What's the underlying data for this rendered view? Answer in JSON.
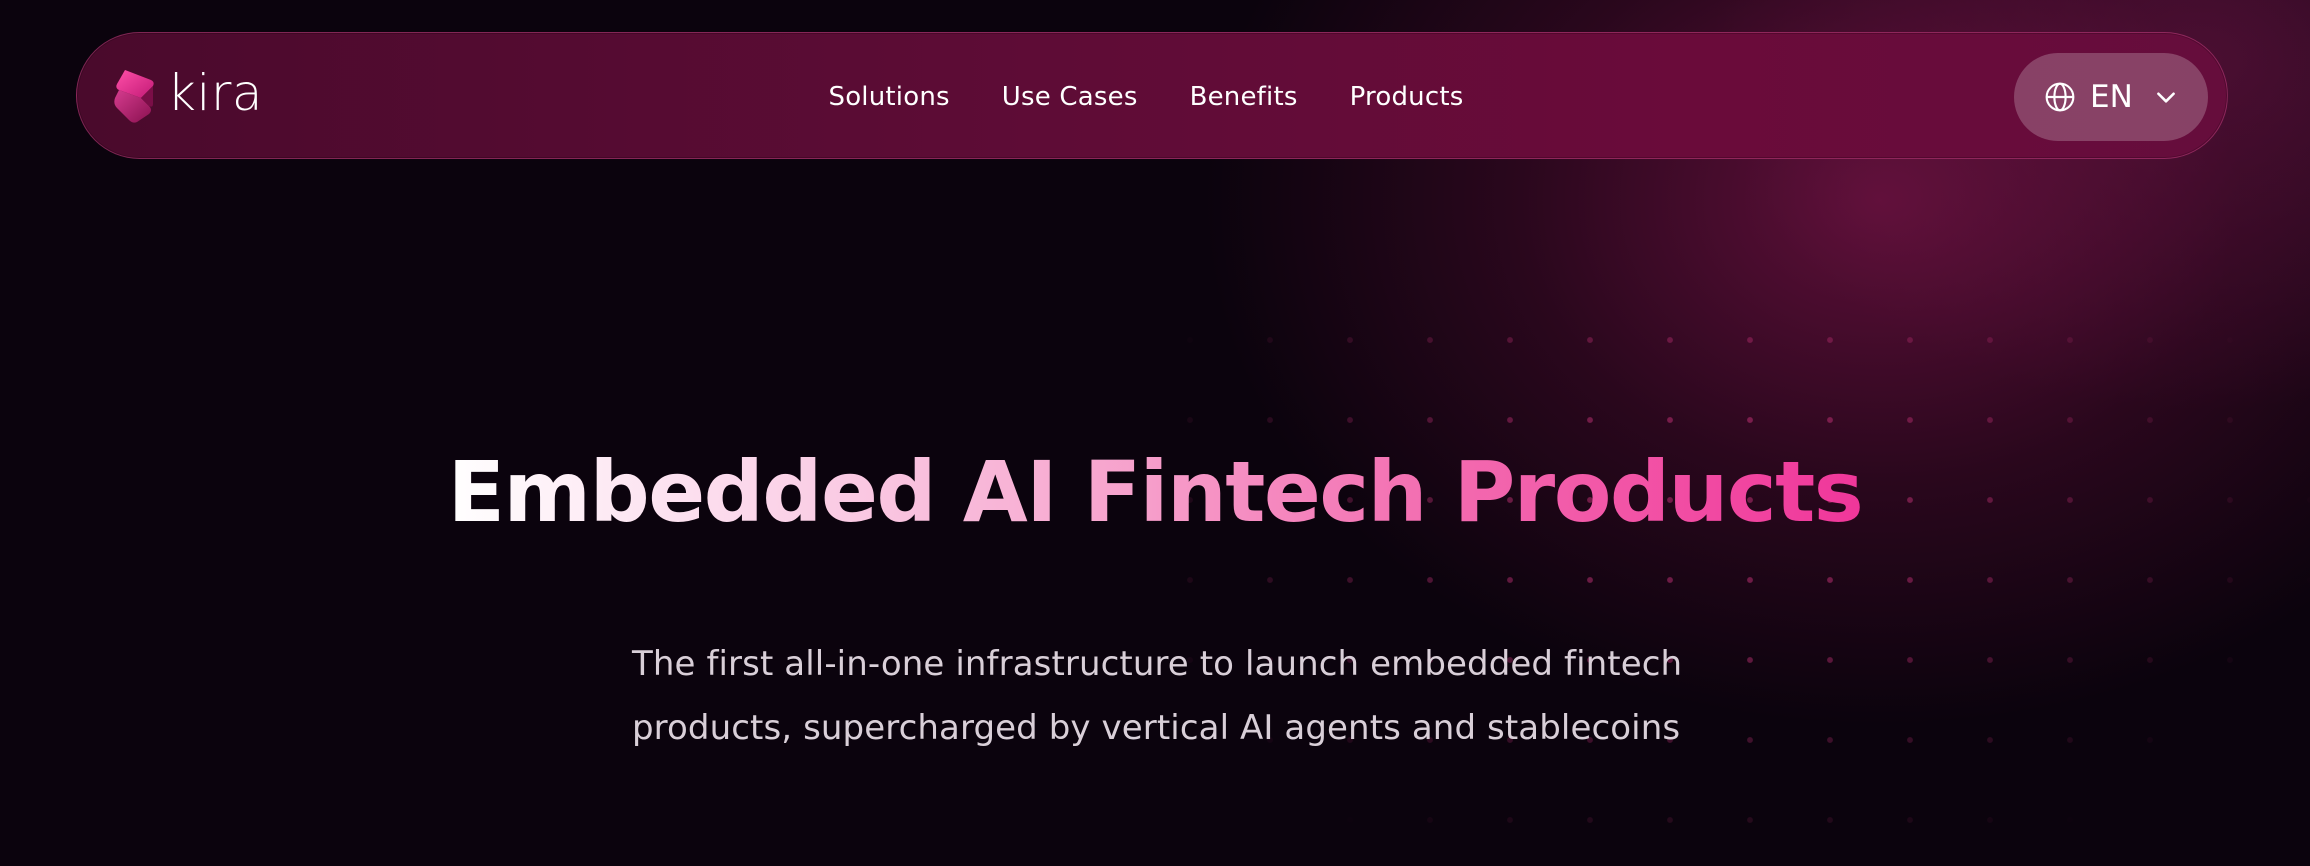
{
  "nav": {
    "brand": "kira",
    "items": [
      "Solutions",
      "Use Cases",
      "Benefits",
      "Products"
    ],
    "language": "EN"
  },
  "hero": {
    "title": "Embedded AI Fintech Products",
    "subtitle_line1": "The first all-in-one infrastructure to launch embedded fintech",
    "subtitle_line2": "products, supercharged by vertical AI agents and stablecoins"
  },
  "icons": {
    "logo": "kira-logo-icon",
    "language": "globe-icon",
    "dropdown": "chevron-down-icon"
  },
  "colors": {
    "background": "#0b030d",
    "nav_background": "#5e0c36",
    "accent_pink": "#f0369a",
    "text_white": "#ffffff",
    "subtitle": "#d9cfd8"
  }
}
